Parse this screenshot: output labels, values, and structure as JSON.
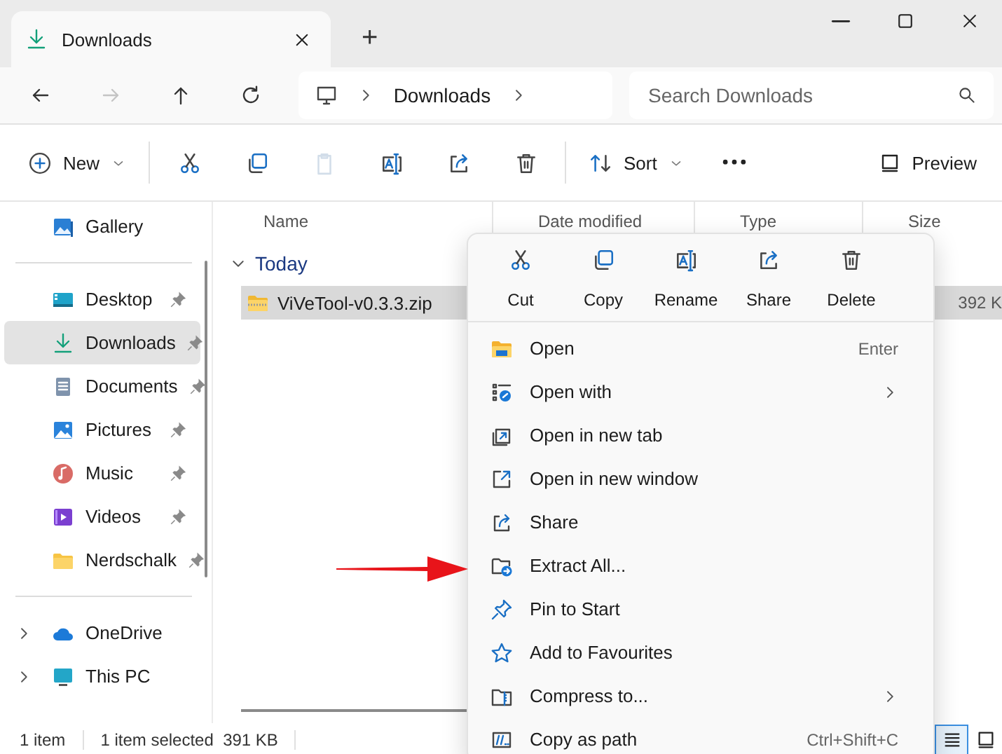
{
  "window": {
    "tab_title": "Downloads",
    "new_tab": "+"
  },
  "nav": {
    "buttons": [
      {
        "kind": "back",
        "disabled": false
      },
      {
        "kind": "forward",
        "disabled": true
      },
      {
        "kind": "up",
        "disabled": false
      },
      {
        "kind": "refresh",
        "disabled": false
      }
    ],
    "breadcrumb": [
      "Downloads"
    ],
    "search": {
      "placeholder": "Search Downloads"
    }
  },
  "toolbar": [
    {
      "kind": "new",
      "label": "New",
      "disabled": false
    },
    {
      "kind": "cut",
      "disabled": false
    },
    {
      "kind": "copy",
      "disabled": false
    },
    {
      "kind": "paste",
      "disabled": true
    },
    {
      "kind": "rename",
      "disabled": false
    },
    {
      "kind": "share",
      "disabled": false
    },
    {
      "kind": "delete",
      "disabled": false
    },
    {
      "kind": "sort",
      "label": "Sort",
      "disabled": false
    },
    {
      "kind": "more",
      "disabled": false
    }
  ],
  "preview_button": "Preview",
  "sidebar": {
    "groups": [
      [
        {
          "label": "Gallery",
          "pinned": false,
          "selected": false,
          "expandable": false
        }
      ],
      [
        {
          "label": "Desktop",
          "pinned": true,
          "selected": false,
          "expandable": false
        },
        {
          "label": "Downloads",
          "pinned": true,
          "selected": true,
          "expandable": false
        },
        {
          "label": "Documents",
          "pinned": true,
          "selected": false,
          "expandable": false
        },
        {
          "label": "Pictures",
          "pinned": true,
          "selected": false,
          "expandable": false
        },
        {
          "label": "Music",
          "pinned": true,
          "selected": false,
          "expandable": false
        },
        {
          "label": "Videos",
          "pinned": true,
          "selected": false,
          "expandable": false
        },
        {
          "label": "Nerdschalk",
          "pinned": true,
          "selected": false,
          "expandable": false
        }
      ],
      [
        {
          "label": "OneDrive",
          "pinned": false,
          "selected": false,
          "expandable": true
        },
        {
          "label": "This PC",
          "pinned": false,
          "selected": false,
          "expandable": true
        }
      ]
    ]
  },
  "table": {
    "columns": [
      "Name",
      "Date modified",
      "Type",
      "Size"
    ],
    "groups": [
      {
        "label": "Today",
        "expanded": true,
        "rows": [
          {
            "name": "ViVeTool-v0.3.3.zip",
            "size": "392 K",
            "selected": true
          }
        ]
      }
    ]
  },
  "context_menu": {
    "actions": [
      {
        "kind": "cut",
        "label": "Cut"
      },
      {
        "kind": "copy",
        "label": "Copy"
      },
      {
        "kind": "rename",
        "label": "Rename"
      },
      {
        "kind": "share",
        "label": "Share"
      },
      {
        "kind": "delete",
        "label": "Delete"
      }
    ],
    "items": [
      {
        "label": "Open",
        "shortcut": "Enter",
        "submenu": false
      },
      {
        "label": "Open with",
        "submenu": true
      },
      {
        "label": "Open in new tab",
        "submenu": false
      },
      {
        "label": "Open in new window",
        "submenu": false
      },
      {
        "label": "Share",
        "submenu": false
      },
      {
        "label": "Extract All...",
        "submenu": false
      },
      {
        "label": "Pin to Start",
        "submenu": false
      },
      {
        "label": "Add to Favourites",
        "submenu": false
      },
      {
        "label": "Compress to...",
        "submenu": true
      },
      {
        "label": "Copy as path",
        "shortcut": "Ctrl+Shift+C",
        "submenu": false
      }
    ]
  },
  "status_bar": {
    "items": "1 item",
    "selection": "1 item selected  391 KB",
    "views": [
      {
        "kind": "details",
        "selected": true
      },
      {
        "kind": "tiles",
        "selected": false
      }
    ]
  }
}
